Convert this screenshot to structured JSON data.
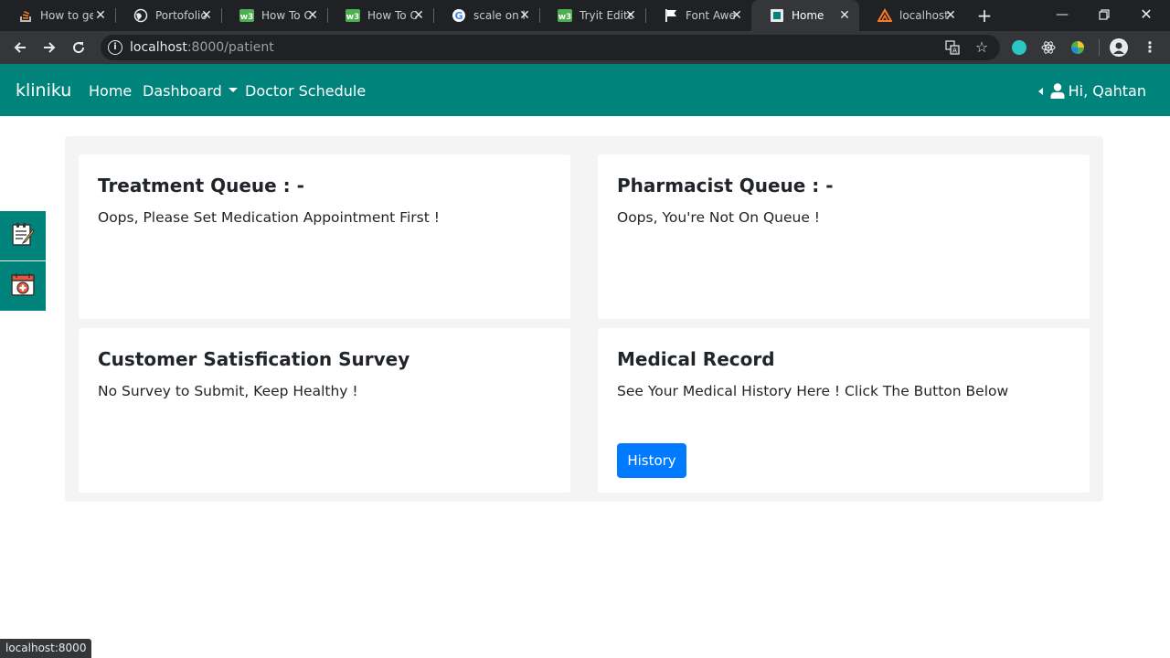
{
  "browser": {
    "tabs": [
      {
        "title": "How to ge",
        "icon": "stackoverflow-icon"
      },
      {
        "title": "Portofolio",
        "icon": "globe-icon"
      },
      {
        "title": "How To C",
        "icon": "w3schools-icon"
      },
      {
        "title": "How To C",
        "icon": "w3schools-icon"
      },
      {
        "title": "scale on h",
        "icon": "google-icon"
      },
      {
        "title": "Tryit Edito",
        "icon": "w3schools-icon"
      },
      {
        "title": "Font Awe",
        "icon": "flag-icon"
      },
      {
        "title": "Home",
        "icon": "page-icon",
        "active": true
      },
      {
        "title": "localhost",
        "icon": "xampp-icon"
      }
    ],
    "address": {
      "host": "localhost",
      "path": ":8000/patient"
    },
    "status_text": "localhost:8000"
  },
  "app": {
    "brand": "kliniku",
    "nav": {
      "home": "Home",
      "dashboard": "Dashboard",
      "doctor_schedule": "Doctor Schedule"
    },
    "user_greeting": "Hi, Qahtan",
    "colors": {
      "navbar": "#00837a",
      "primary_button": "#007bff",
      "panel_background": "#f4f4f4"
    }
  },
  "cards": {
    "treatment": {
      "title": "Treatment Queue : -",
      "text": "Oops, Please Set Medication Appointment First !"
    },
    "pharmacist": {
      "title": "Pharmacist Queue : -",
      "text": "Oops, You're Not On Queue !"
    },
    "survey": {
      "title": "Customer Satisfication Survey",
      "text": "No Survey to Submit, Keep Healthy !"
    },
    "medical_record": {
      "title": "Medical Record",
      "text": "See Your Medical History Here ! Click The Button Below",
      "button": "History"
    }
  },
  "side_buttons": [
    {
      "icon": "notepad-icon"
    },
    {
      "icon": "medical-calendar-icon"
    }
  ]
}
